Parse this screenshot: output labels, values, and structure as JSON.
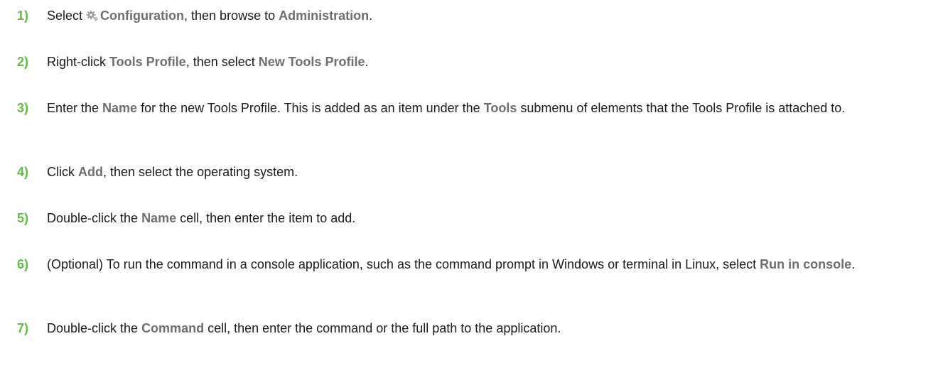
{
  "steps": [
    {
      "number": "1)",
      "parts": {
        "t1": "Select ",
        "icon": "gear-icon",
        "b1": "Configuration",
        "t2": ", then browse to ",
        "b2": "Administration",
        "t3": "."
      }
    },
    {
      "number": "2)",
      "parts": {
        "t1": "Right-click ",
        "b1": "Tools Profile",
        "t2": ", then select ",
        "b2": "New Tools Profile",
        "t3": "."
      }
    },
    {
      "number": "3)",
      "parts": {
        "t1": "Enter the ",
        "b1": "Name",
        "t2": " for the new Tools Profile. This is added as an item under the ",
        "b2": "Tools",
        "t3": " submenu of elements that the Tools Profile is attached to."
      }
    },
    {
      "number": "4)",
      "parts": {
        "t1": "Click ",
        "b1": "Add",
        "t2": ", then select the operating system."
      }
    },
    {
      "number": "5)",
      "parts": {
        "t1": "Double-click the ",
        "b1": "Name",
        "t2": " cell, then enter the item to add."
      }
    },
    {
      "number": "6)",
      "parts": {
        "t1": "(Optional) To run the command in a console application, such as the command prompt in Windows or terminal in Linux, select ",
        "b1": "Run in console",
        "t2": "."
      }
    },
    {
      "number": "7)",
      "parts": {
        "t1": "Double-click the ",
        "b1": "Command",
        "t2": " cell, then enter the command or the full path to the application."
      }
    }
  ],
  "colors": {
    "step_number": "#62bb46",
    "ui_term": "#6e6e6e",
    "body_text": "#1a1a1a"
  }
}
